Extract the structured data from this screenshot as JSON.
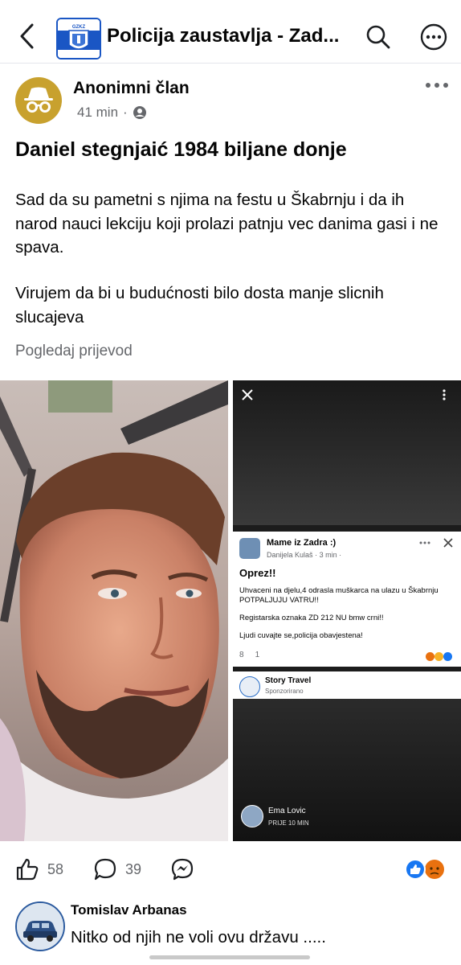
{
  "header": {
    "title": "Policija zaustavlja - Zad...",
    "logo_text": "GZKZ"
  },
  "post": {
    "author": "Anonimni član",
    "time": "41 min",
    "dot": "·",
    "title": "Daniel stegnjaić 1984 biljane donje",
    "body_paragraph_1": "Sad da su pametni s njima na festu u Škabrnju i da ih narod nauci lekciju koji prolazi patnju vec danima gasi i ne spava.",
    "body_paragraph_2": "Virujem da bi u budućnosti bilo dosta manje slicnih slucajeva",
    "translate_link": "Pogledaj prijevod"
  },
  "embedded": {
    "group_name": "Mame iz Zadra :)",
    "poster": "Danijela Kulaš",
    "poster_time": "3 min",
    "heading": "Oprez!!",
    "line1": "Uhvaceni na djelu,4 odrasla muškarca na ulazu u Škabrnju POTPALJUJU VATRU!!",
    "line2": "Registarska oznaka ZD 212 NU bmw crni!!",
    "line3": "Ljudi cuvajte se,policija obavjestena!",
    "likes": "8",
    "comments": "1",
    "sponsor_name": "Story Travel",
    "sponsor_label": "Sponzorirano",
    "story_user": "Ema Lovic",
    "story_time": "PRIJE 10 MIN"
  },
  "actions": {
    "likes": "58",
    "comments": "39"
  },
  "comment": {
    "author": "Tomislav Arbanas",
    "text": "Nitko od njih ne voli ovu državu ....."
  },
  "icons": [
    "back-arrow-icon",
    "search-icon",
    "more-icon",
    "incognito-icon",
    "members-icon",
    "like-icon",
    "comment-icon",
    "messenger-icon",
    "like-reaction-icon",
    "angry-reaction-icon",
    "close-icon"
  ],
  "colors": {
    "accent": "#1877f2",
    "avatar": "#c8a12e",
    "muted": "#65676b"
  }
}
